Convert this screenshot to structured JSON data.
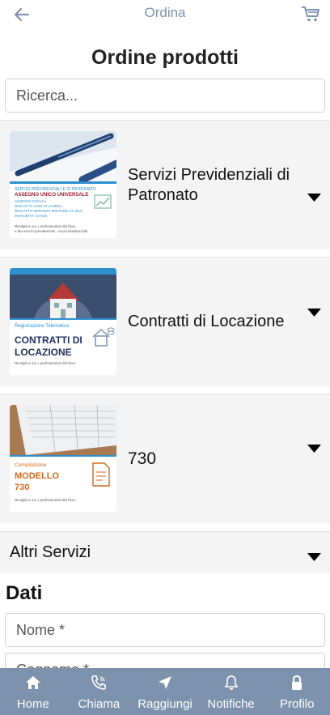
{
  "header": {
    "title": "Ordina",
    "back_icon": "arrow-left-icon",
    "cart_icon": "cart-icon"
  },
  "page_title": "Ordine prodotti",
  "search": {
    "placeholder": "Ricerca..."
  },
  "products": [
    {
      "name": "Servizi Previdenziali di Patronato",
      "thumb": {
        "line1": "SERVIZI PREVIDENZIALI E DI PATRONATO",
        "line2": "ASSEGNO UNICO UNIVERSALE",
        "line3": "ASSEGNI SOCIALI",
        "line4": "RISCATTO ANNI DI LAUREA",
        "line5": "RISCATTO SERVIZIO MILITARE DI LEVA",
        "line6": "INVALIDITA' CIVILE",
        "footer1": "Rivolgiti a noi, i professionisti del fisco",
        "footer2": "e dei servizi previdenziali - socio-assistenziali"
      }
    },
    {
      "name": "Contratti di Locazione",
      "thumb": {
        "line1": "Registrazione Telematica",
        "line2": "CONTRATTI DI",
        "line3": "LOCAZIONE",
        "footer1": "Rivolgiti a noi, i professionisti del fisco"
      }
    },
    {
      "name": "730",
      "thumb": {
        "line1": "Compilazione",
        "line2": "MODELLO",
        "line3": "730",
        "footer1": "Rivolgiti a noi, i professionisti del fisco"
      }
    }
  ],
  "altri": {
    "name": "Altri Servizi"
  },
  "dati": {
    "title": "Dati",
    "nome_placeholder": "Nome *",
    "cognome_placeholder": "Cognome *"
  },
  "tabbar": [
    {
      "label": "Home",
      "icon": "home-icon"
    },
    {
      "label": "Chiama",
      "icon": "phone-icon"
    },
    {
      "label": "Raggiungi",
      "icon": "location-arrow-icon"
    },
    {
      "label": "Notifiche",
      "icon": "bell-icon"
    },
    {
      "label": "Profilo",
      "icon": "lock-icon"
    }
  ],
  "colors": {
    "accent": "#7d92ad",
    "card_bg": "#f4f4f4",
    "thumb_blue": "#2d8fd0",
    "thumb_red": "#9b1b2e",
    "thumb_orange": "#d06a1a",
    "thumb_navy": "#24305f"
  }
}
